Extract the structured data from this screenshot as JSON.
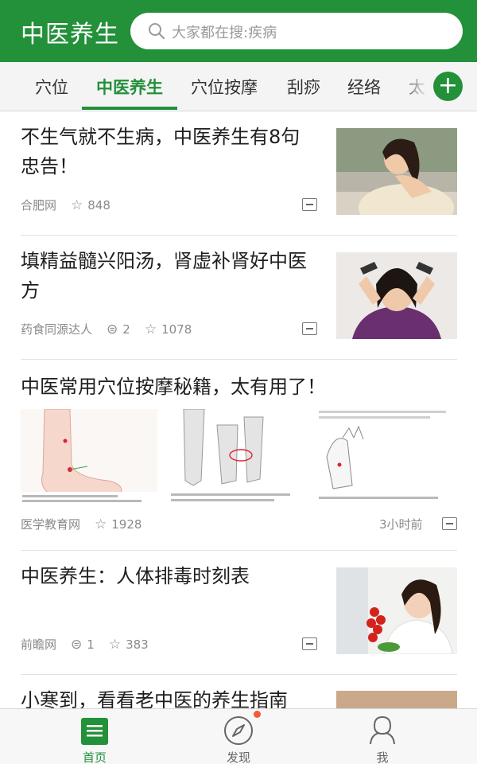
{
  "header": {
    "app_title": "中医养生",
    "search_placeholder": "大家都在搜:疾病"
  },
  "tabs": [
    {
      "label": "穴位"
    },
    {
      "label": "中医养生",
      "active": true
    },
    {
      "label": "穴位按摩"
    },
    {
      "label": "刮痧"
    },
    {
      "label": "经络"
    },
    {
      "label": "太"
    }
  ],
  "feed": [
    {
      "title": "不生气就不生病，中医养生有8句忠告！",
      "source": "合肥网",
      "stars": "848",
      "thumb_icon": "woman-neck-pain-photo"
    },
    {
      "title": "填精益髓兴阳汤，肾虚补肾好中医方",
      "source": "药食同源达人",
      "comments": "2",
      "stars": "1078",
      "thumb_icon": "woman-headache-photo"
    },
    {
      "title": "中医常用穴位按摩秘籍，太有用了！",
      "source": "医学教育网",
      "stars": "1928",
      "time": "3小时前",
      "images": [
        "foot-acupoint-diagram",
        "leg-acupoint-diagram",
        "hand-acupoint-diagram"
      ]
    },
    {
      "title": "中医养生：人体排毒时刻表",
      "source": "前瞻网",
      "comments": "1",
      "stars": "383",
      "thumb_icon": "woman-tomatoes-photo"
    },
    {
      "title": "小寒到，看看老中医的养生指南"
    }
  ],
  "bottom_nav": [
    {
      "label": "首页",
      "icon": "home-list-icon",
      "active": true
    },
    {
      "label": "发现",
      "icon": "compass-icon",
      "badge": true
    },
    {
      "label": "我",
      "icon": "user-icon"
    }
  ],
  "colors": {
    "brand_green": "#23903a",
    "badge_red": "#f45a34"
  }
}
